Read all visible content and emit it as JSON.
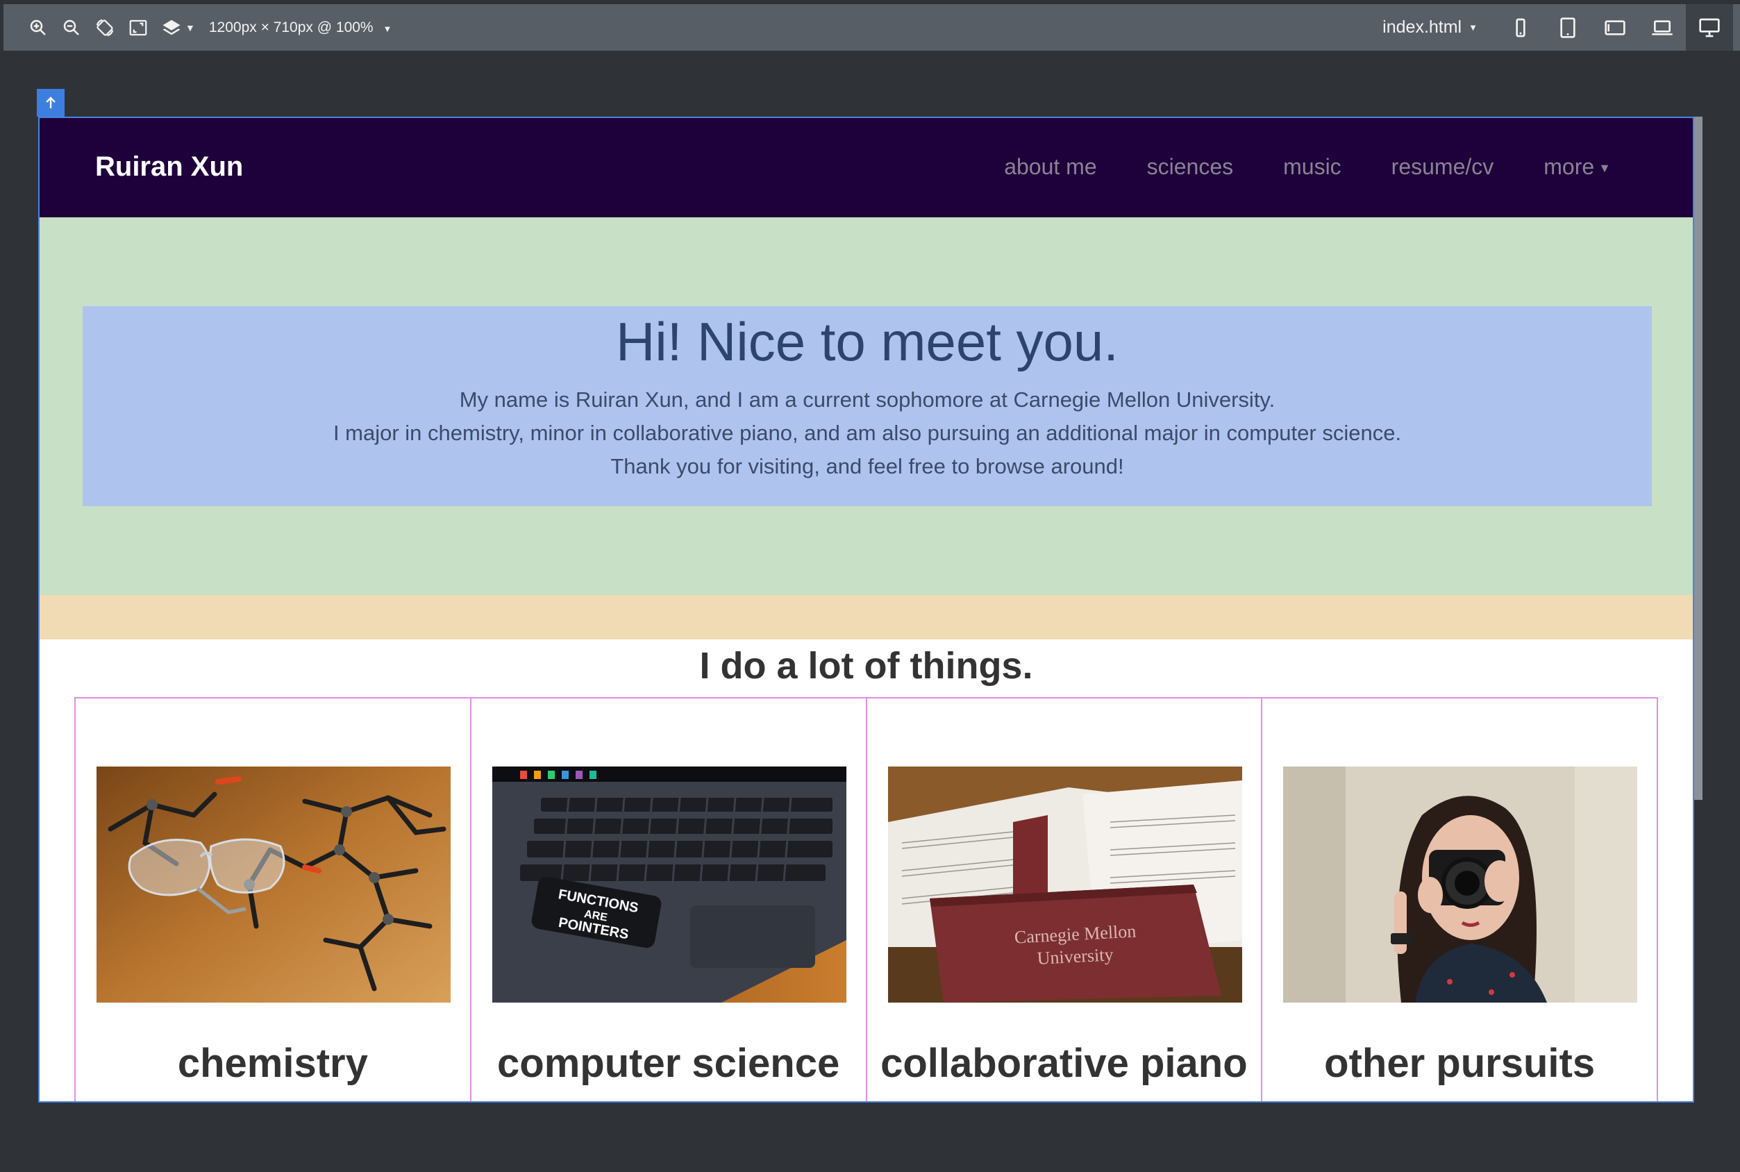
{
  "toolbar": {
    "viewport_label": "1200px × 710px @ 100%",
    "file": "index.html",
    "tools": [
      "zoom-in-icon",
      "zoom-out-icon",
      "rotate-icon",
      "screenshot-icon",
      "layers-icon"
    ],
    "devices": [
      "phone-icon",
      "tablet-portrait-icon",
      "tablet-landscape-icon",
      "laptop-icon",
      "desktop-icon"
    ],
    "active_device": "desktop-icon"
  },
  "site": {
    "brand": "Ruiran Xun",
    "nav": [
      "about me",
      "sciences",
      "music",
      "resume/cv",
      "more"
    ],
    "hero": {
      "title": "Hi! Nice to meet you.",
      "lines": [
        "My name is Ruiran Xun, and I am a current sophomore at Carnegie Mellon University.",
        "I major in chemistry, minor in collaborative piano, and am also pursuing an additional major in computer science.",
        "Thank you for visiting, and feel free to browse around!"
      ]
    },
    "section_title": "I do a lot of things.",
    "cards": [
      {
        "title": "chemistry"
      },
      {
        "title": "computer science",
        "sticker": "FUNCTIONS ARE POINTERS"
      },
      {
        "title": "collaborative piano",
        "book_text": "Carnegie Mellon University"
      },
      {
        "title": "other pursuits"
      }
    ]
  },
  "colors": {
    "nav_bg": "#1e003a",
    "hero_bg": "#c8e0c5",
    "jumbotron_bg": "#aec4ef",
    "stripe_bg": "#f0dbb4",
    "card_border": "#e28ee0",
    "frame_outline": "#4a84e0"
  }
}
